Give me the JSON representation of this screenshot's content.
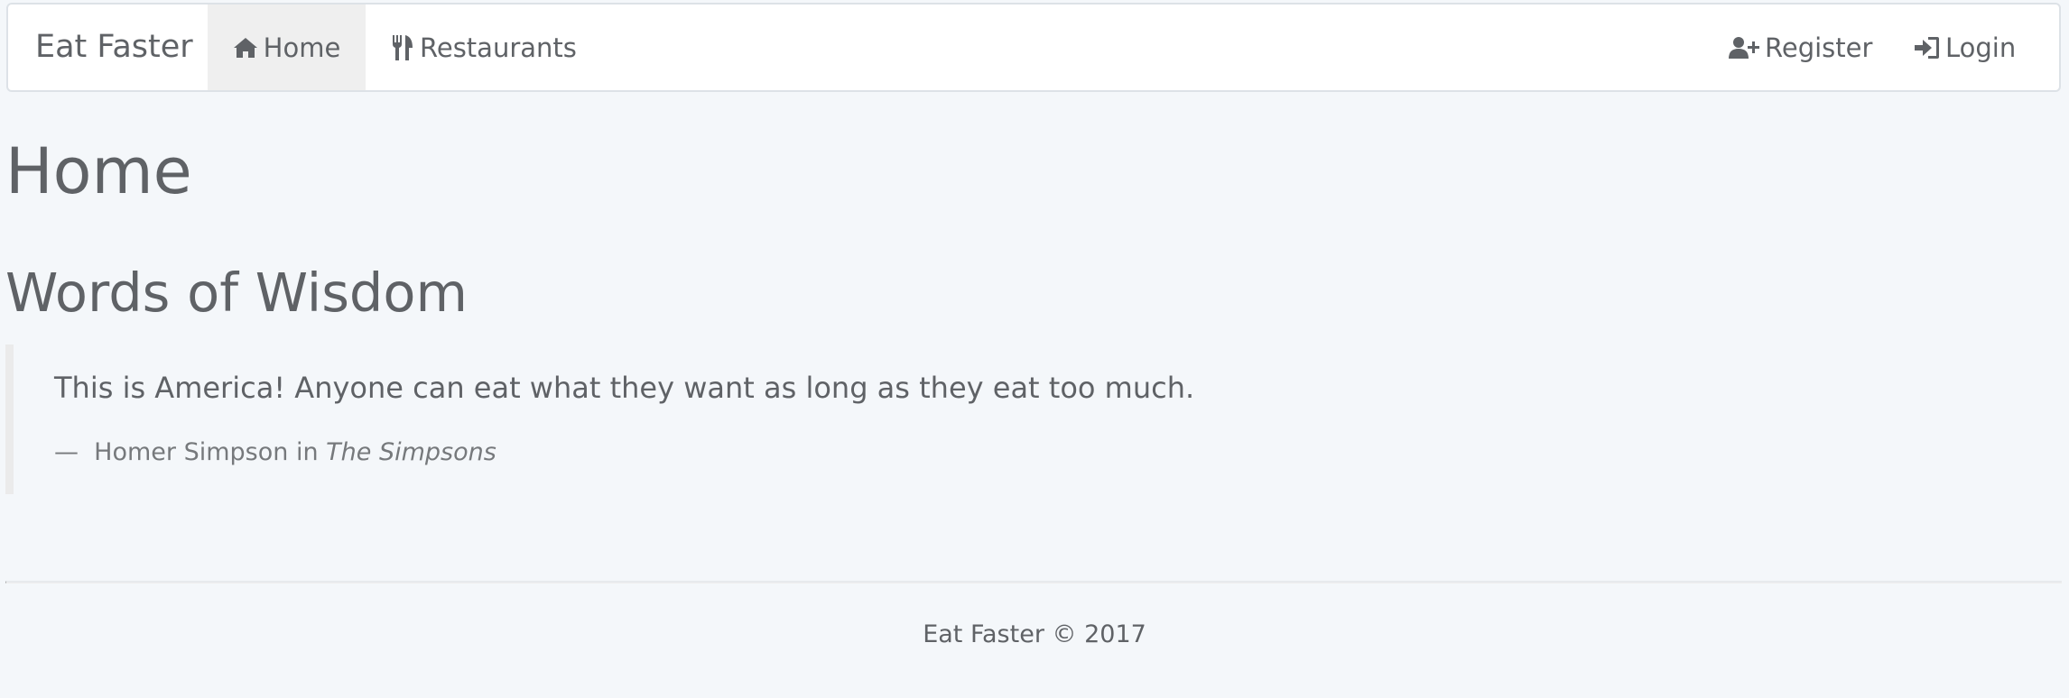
{
  "navbar": {
    "brand": "Eat Faster",
    "items": [
      {
        "label": "Home",
        "icon": "home-icon",
        "active": true
      },
      {
        "label": "Restaurants",
        "icon": "cutlery-icon",
        "active": false
      }
    ],
    "right_items": [
      {
        "label": "Register",
        "icon": "user-plus-icon"
      },
      {
        "label": "Login",
        "icon": "sign-in-icon"
      }
    ]
  },
  "main": {
    "title": "Home",
    "section_title": "Words of Wisdom",
    "quote": {
      "text": "This is America! Anyone can eat what they want as long as they eat too much.",
      "dash": "—",
      "author": "Homer Simpson in",
      "source": "The Simpsons"
    }
  },
  "footer": {
    "text": "Eat Faster © 2017"
  },
  "colors": {
    "background": "#f4f7fa",
    "text": "#5f6266",
    "navbar_background": "#ffffff",
    "active_tab": "#efefef"
  }
}
